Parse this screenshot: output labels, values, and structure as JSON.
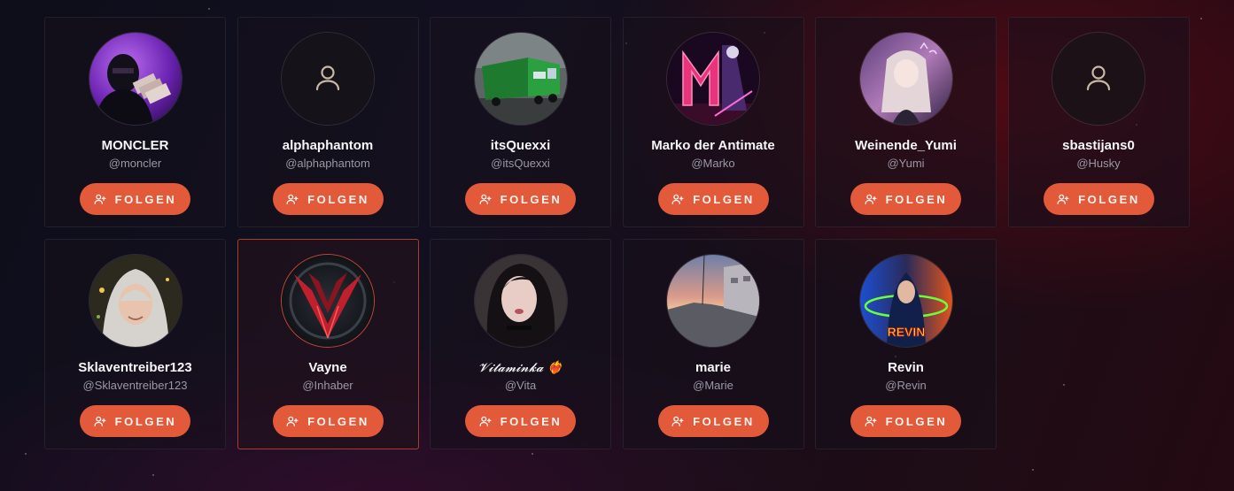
{
  "colors": {
    "accent": "#e35a3a",
    "card_border_active": "#d64e34",
    "handle_text": "#9a98a4"
  },
  "users": [
    {
      "name": "MONCLER",
      "handle": "@moncler",
      "follow_label": "FOLGEN",
      "avatar_icon": "masked-man-money-photo"
    },
    {
      "name": "alphaphantom",
      "handle": "@alphaphantom",
      "follow_label": "FOLGEN",
      "avatar_icon": "user-placeholder-icon"
    },
    {
      "name": "itsQuexxi",
      "handle": "@itsQuexxi",
      "follow_label": "FOLGEN",
      "avatar_icon": "green-truck-photo"
    },
    {
      "name": "Marko der Antimate",
      "handle": "@Marko",
      "follow_label": "FOLGEN",
      "avatar_icon": "neon-m-logo"
    },
    {
      "name": "Weinende_Yumi",
      "handle": "@Yumi",
      "follow_label": "FOLGEN",
      "avatar_icon": "anime-girl-art"
    },
    {
      "name": "sbastijans0",
      "handle": "@Husky",
      "follow_label": "FOLGEN",
      "avatar_icon": "user-placeholder-icon"
    },
    {
      "name": "Sklaventreiber123",
      "handle": "@Sklaventreiber123",
      "follow_label": "FOLGEN",
      "avatar_icon": "hooded-person-photo"
    },
    {
      "name": "Vayne",
      "handle": "@Inhaber",
      "follow_label": "FOLGEN",
      "avatar_icon": "red-v-logo",
      "highlighted": true
    },
    {
      "name": "𝓥𝓲𝓽𝓪𝓶𝓲𝓷𝓴𝓪 ❤️‍🔥",
      "handle": "@Vita",
      "follow_label": "FOLGEN",
      "avatar_icon": "woman-selfie-photo"
    },
    {
      "name": "marie",
      "handle": "@Marie",
      "follow_label": "FOLGEN",
      "avatar_icon": "sunset-street-photo"
    },
    {
      "name": "Revin",
      "handle": "@Revin",
      "follow_label": "FOLGEN",
      "avatar_icon": "revin-logo",
      "avatar_text": "REVIN"
    }
  ]
}
